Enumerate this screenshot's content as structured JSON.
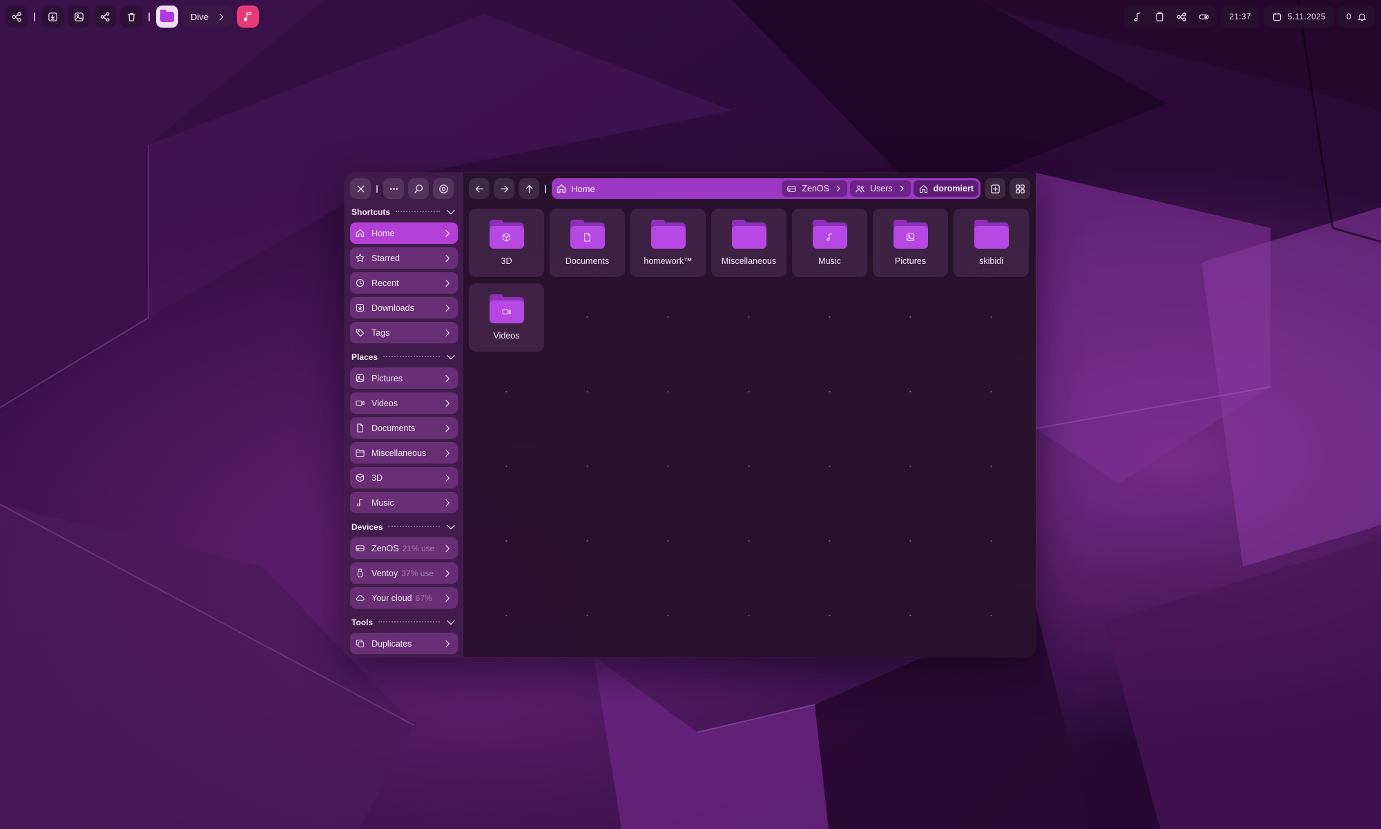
{
  "topbar_left": {
    "buttons": [
      {
        "icon": "share-nodes-icon"
      },
      {
        "icon": "download-icon"
      },
      {
        "icon": "image-icon"
      },
      {
        "icon": "share-icon"
      },
      {
        "icon": "trash-icon"
      }
    ],
    "app_pill_label": "Dive",
    "accent": "#b238e0",
    "music_app_color": "#e43a78"
  },
  "topbar_right": {
    "group_icons": [
      "music-note-icon",
      "clipboard-icon",
      "network-icon",
      "toggle-icon"
    ],
    "time": "21:37",
    "date": "5.11.2025",
    "notification_count": "0"
  },
  "sidebar": {
    "sections": [
      {
        "title": "Shortcuts",
        "items": [
          {
            "label": "Home",
            "icon": "home-icon",
            "active": true
          },
          {
            "label": "Starred",
            "icon": "star-icon"
          },
          {
            "label": "Recent",
            "icon": "clock-icon"
          },
          {
            "label": "Downloads",
            "icon": "download-icon"
          },
          {
            "label": "Tags",
            "icon": "tag-icon"
          }
        ]
      },
      {
        "title": "Places",
        "items": [
          {
            "label": "Pictures",
            "icon": "image-icon"
          },
          {
            "label": "Videos",
            "icon": "video-icon"
          },
          {
            "label": "Documents",
            "icon": "document-icon"
          },
          {
            "label": "Miscellaneous",
            "icon": "folder-icon"
          },
          {
            "label": "3D",
            "icon": "cube-icon"
          },
          {
            "label": "Music",
            "icon": "music-note-icon"
          }
        ]
      },
      {
        "title": "Devices",
        "items": [
          {
            "label": "ZenOS",
            "sub": "21% use",
            "icon": "drive-icon"
          },
          {
            "label": "Ventoy",
            "sub": "37% use",
            "icon": "usb-icon"
          },
          {
            "label": "Your cloud",
            "sub": "67%",
            "icon": "cloud-icon"
          }
        ]
      },
      {
        "title": "Tools",
        "items": [
          {
            "label": "Duplicates",
            "icon": "duplicates-icon"
          }
        ]
      }
    ]
  },
  "pathbar": {
    "current_label": "Home",
    "crumbs": [
      {
        "label": "ZenOS",
        "icon": "drive-icon"
      },
      {
        "label": "Users",
        "icon": "users-icon"
      },
      {
        "label": "doromiert",
        "icon": "home-icon"
      }
    ]
  },
  "folders": [
    {
      "name": "3D",
      "icon": "cube-icon"
    },
    {
      "name": "Documents",
      "icon": "document-icon"
    },
    {
      "name": "homework™",
      "icon": ""
    },
    {
      "name": "Miscellaneous",
      "icon": ""
    },
    {
      "name": "Music",
      "icon": "music-note-icon"
    },
    {
      "name": "Pictures",
      "icon": "image-icon"
    },
    {
      "name": "skibidi",
      "icon": ""
    },
    {
      "name": "Videos",
      "icon": "video-icon"
    }
  ]
}
